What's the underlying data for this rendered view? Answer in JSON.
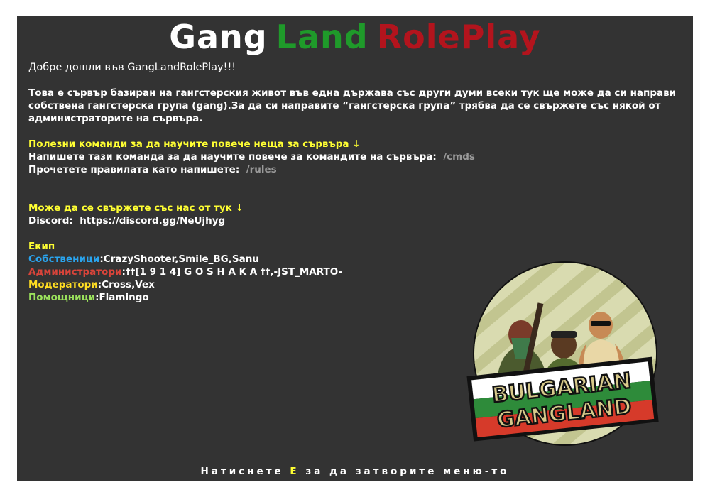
{
  "title": {
    "part1": "Gang",
    "part2": "Land",
    "part3": "RolePlay",
    "color1": "#ffffff",
    "color2": "#1f9a2a",
    "color3": "#b3141d"
  },
  "welcome": "Добре дошли във GangLandRolePlay!!!",
  "intro": "Това е сървър базиран на гангстерския живот във една държава със други думи всеки тук ще може да си направи собствена гангстерска група (gang).За да си направите “гангстерска група” трябва да се свържете със някой от администраторите на сървъра.",
  "commands": {
    "heading": "Полезни команди за да научите повече неща за сървъра ↓",
    "line1_text": "Напишете тази команда за да научите повече за командите на сървъра:",
    "line1_cmd": "/cmds",
    "line2_text": "Прочетете правилата като напишете:",
    "line2_cmd": "/rules"
  },
  "contact": {
    "heading": "Може да се свържете със нас от тук ↓",
    "label": "Discord:",
    "value": "https://discord.gg/NeUjhyg"
  },
  "team": {
    "heading": "Екип",
    "owners_label": "Собственици",
    "owners": ":CrazyShooter,Smile_BG,Sanu",
    "admins_label": "Администратори",
    "admins": ":††[1 9 1 4] G O S H A K A ††,-JST_MARTO-",
    "mods_label": "Модератори",
    "mods": ":Cross,Vex",
    "helpers_label": "Помощници",
    "helpers": ":Flamingo"
  },
  "logo": {
    "line1": "BULGARIAN",
    "line2": "GANGLAND",
    "flag_colors": [
      "#ffffff",
      "#2e8b3a",
      "#d63a2a"
    ]
  },
  "footer": {
    "before": "Натиснете",
    "key": "E",
    "after": "за да затворите меню-то"
  }
}
